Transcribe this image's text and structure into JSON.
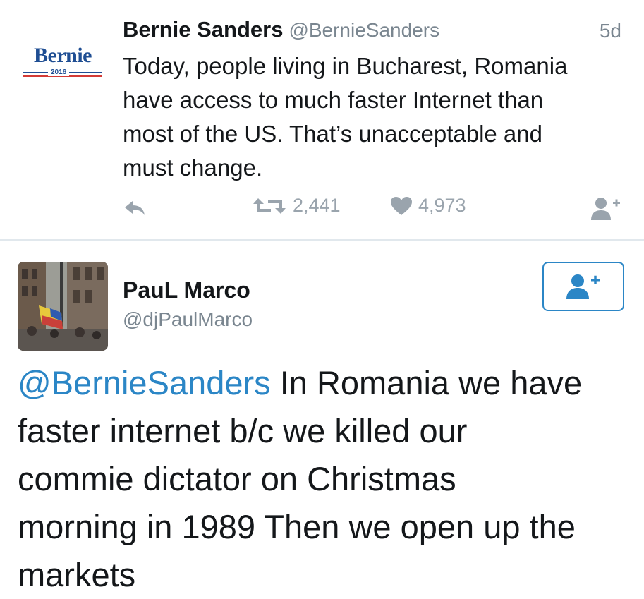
{
  "tweet1": {
    "avatar": {
      "word": "Bernie",
      "year": "2016"
    },
    "name": "Bernie Sanders",
    "handle": "@BernieSanders",
    "time": "5d",
    "text": "Today, people living in Bucharest, Romania\nhave access to much faster Internet than\nmost of the US. That’s unacceptable and\nmust change.",
    "retweets": "2,441",
    "likes": "4,973",
    "icons": {
      "reply": "reply-icon",
      "retweet": "retweet-icon",
      "like": "heart-icon",
      "follow": "follow-user-icon"
    }
  },
  "tweet2": {
    "name": "PauL Marco",
    "handle": "@djPaulMarco",
    "mention": "@BernieSanders",
    "text": " In Romania we have\nfaster internet b/c we killed our\ncommie dictator on Christmas\nmorning in 1989 Then we open up the\nmarkets",
    "icons": {
      "follow": "follow-user-icon"
    }
  },
  "colors": {
    "link": "#2b86c6",
    "muted": "#7a8690",
    "icon": "#9aa4ad",
    "bernie_blue": "#1f4e93",
    "bernie_red": "#d33a36"
  }
}
